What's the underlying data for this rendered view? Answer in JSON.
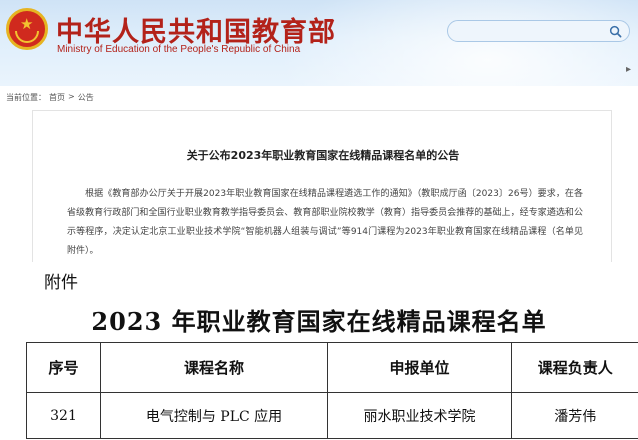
{
  "header": {
    "ministry_cn": "中华人民共和国教育部",
    "ministry_en": "Ministry of Education of the People's Republic of China",
    "search_placeholder": "",
    "search_icon": "search-icon",
    "menu_icon": "▸"
  },
  "breadcrumb": {
    "prefix": "当前位置：",
    "items": [
      "首页",
      "公告"
    ],
    "separator": ">"
  },
  "article": {
    "title": "关于公布2023年职业教育国家在线精品课程名单的公告",
    "body": "根据《教育部办公厅关于开展2023年职业教育国家在线精品课程遴选工作的通知》（教职成厅函〔2023〕26号）要求，在各省级教育行政部门和全国行业职业教育教学指导委员会、教育部职业院校教学（教育）指导委员会推荐的基础上，经专家遴选和公示等程序，决定认定北京工业职业技术学院“智能机器人组装与调试”等914门课程为2023年职业教育国家在线精品课程（名单见附件）。"
  },
  "attachment": {
    "label": "附件",
    "title": "2023 年职业教育国家在线精品课程名单",
    "columns": [
      "序号",
      "课程名称",
      "申报单位",
      "课程负责人"
    ],
    "rows": [
      [
        "321",
        "电气控制与 PLC 应用",
        "丽水职业技术学院",
        "潘芳伟"
      ]
    ]
  },
  "colors": {
    "brand_red": "#b3221a",
    "header_blue": "#cfe3f6"
  }
}
